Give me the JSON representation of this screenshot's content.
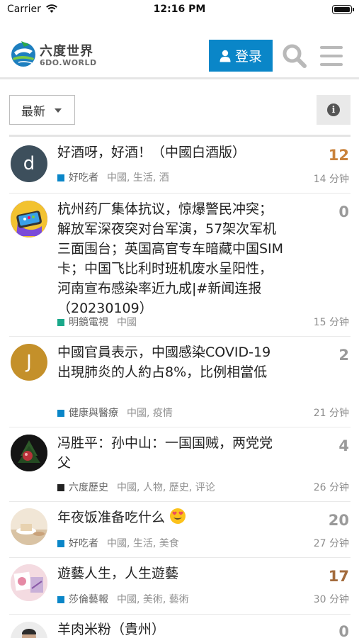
{
  "status_bar": {
    "carrier": "Carrier",
    "time": "12:16 PM"
  },
  "header": {
    "logo_cn": "六度世界",
    "logo_en": "6DO.WORLD",
    "login_label": "登录",
    "brand_color": "#0a86c8"
  },
  "filter": {
    "sort_label": "最新",
    "info_glyph": "i"
  },
  "topics": [
    {
      "title": "好酒呀，好酒！（中國白酒版）",
      "avatar_letter": "d",
      "avatar_color": "#3d4f5c",
      "category": "好吃者",
      "category_color": "#0a86c8",
      "tags": "中國, 生活, 酒",
      "count": "12",
      "ago": "14 分钟"
    },
    {
      "title": "杭州药厂集体抗议，惊爆警民冲突；解放军深夜突对台军演，57架次军机三面围台；英国高官专车暗藏中国SIM卡；中国飞比利时班机废水呈阳性，河南宣布感染率近九成|#新闻连报（20230109）",
      "avatar_icon": "phone-icon",
      "category": "明鏡電視",
      "category_color": "#1aa88a",
      "tags": "中國",
      "count": "0",
      "ago": "15 分钟"
    },
    {
      "title": "中國官員表示，中國感染COVID-19出現肺炎的人約占8%，比例相當低",
      "avatar_letter": "J",
      "avatar_color": "#c4902a",
      "category": "健康與醫療",
      "category_color": "#0a86c8",
      "tags": "中國, 疫情",
      "count": "2",
      "ago": "21 分钟"
    },
    {
      "title": "冯胜平：孙中山：一国国贼，两党党父",
      "avatar_icon": "tree-photo-icon",
      "category": "六度歷史",
      "category_color": "#222222",
      "tags": "中國, 人物, 歷史, 评论",
      "count": "4",
      "ago": "26 分钟"
    },
    {
      "title": "年夜饭准备吃什么",
      "title_emoji": "heart-eyes-emoji",
      "avatar_icon": "food-photo-icon",
      "category": "好吃者",
      "category_color": "#0a86c8",
      "tags": "中國, 生活, 美食",
      "count": "20",
      "ago": "27 分钟"
    },
    {
      "title": "遊藝人生，人生遊藝",
      "avatar_icon": "art-photo-icon",
      "category": "莎倫藝報",
      "category_color": "#0a86c8",
      "tags": "中國, 美術, 藝術",
      "count": "17",
      "ago": "30 分钟"
    },
    {
      "title": "羊肉米粉（貴州）",
      "avatar_icon": "person-photo-icon",
      "count": "0"
    }
  ]
}
